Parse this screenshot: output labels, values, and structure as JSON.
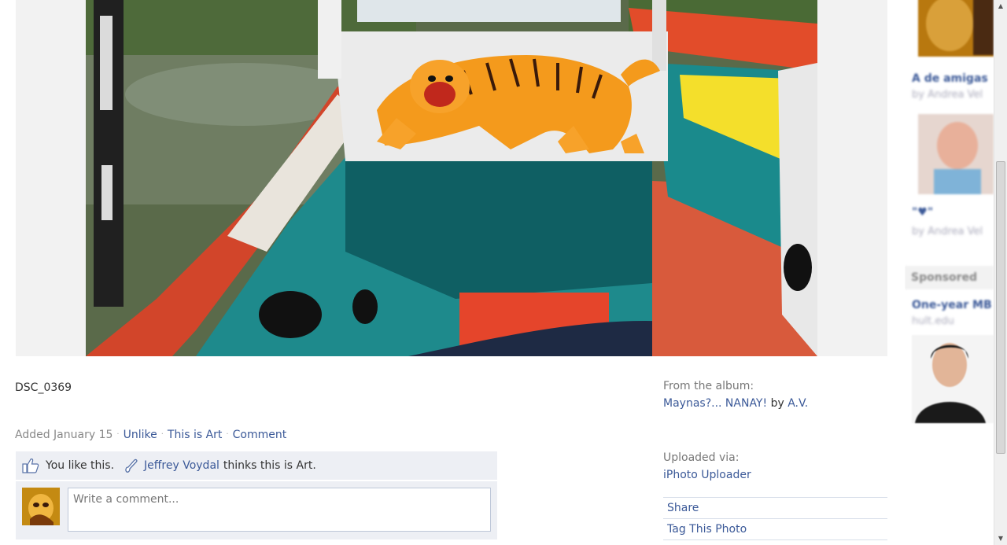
{
  "photo": {
    "caption": "DSC_0369",
    "alt": "Painted tiger on a boat"
  },
  "meta": {
    "added": "Added January 15",
    "unlike": "Unlike",
    "this_is_art": "This is Art",
    "comment": "Comment"
  },
  "likes": {
    "you_like": "You like this.",
    "art_user": "Jeffrey Voydal",
    "art_suffix": "thinks this is Art."
  },
  "comment_box": {
    "placeholder": "Write a comment..."
  },
  "album": {
    "from_label": "From the album:",
    "name": "Maynas?... NANAY!",
    "by_word": "by",
    "author": "A.V.",
    "uploaded_label": "Uploaded via:",
    "uploader": "iPhoto Uploader"
  },
  "actions": {
    "share": "Share",
    "tag": "Tag This Photo"
  },
  "sidebar": {
    "item1_title": "A de amigas",
    "item1_by": "by Andrea Vel",
    "item2_title": "\"♥\"",
    "item2_by": "by Andrea Vel",
    "sponsored": "Sponsored",
    "ad_title": "One-year MB",
    "ad_sub": "hult.edu"
  },
  "colors": {
    "link": "#3b5998",
    "panel": "#edeff4"
  }
}
